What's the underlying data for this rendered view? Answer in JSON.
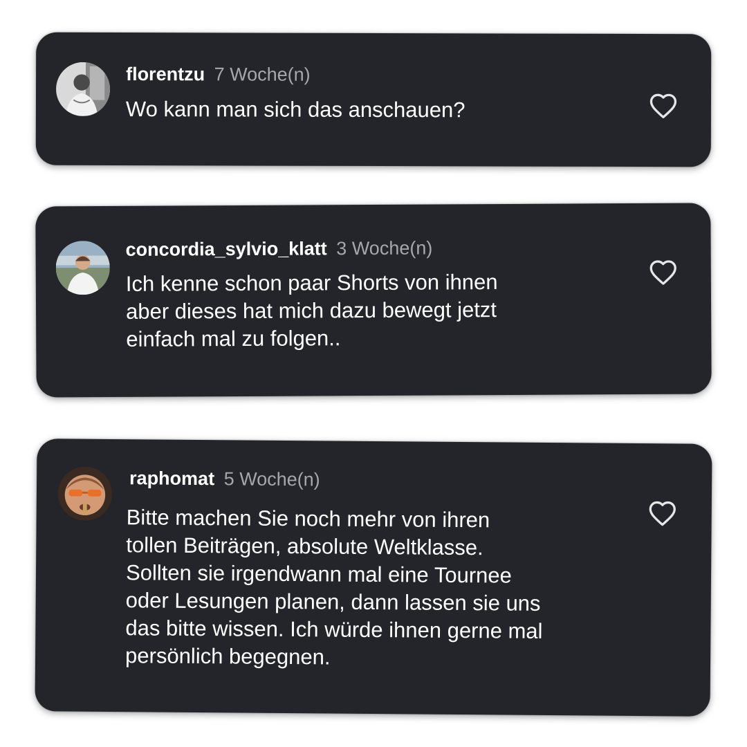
{
  "comments": [
    {
      "username": "florentzu",
      "time": "7 Woche(n)",
      "text": "Wo kann man sich das anschauen?",
      "avatar": "user-avatar-photo",
      "like_icon": "heart-outline-icon"
    },
    {
      "username": "concordia_sylvio_klatt",
      "time": "3 Woche(n)",
      "text": "Ich kenne schon paar Shorts von ihnen\naber dieses hat mich dazu bewegt jetzt\neinfach mal zu folgen..",
      "avatar": "user-avatar-photo",
      "like_icon": "heart-outline-icon"
    },
    {
      "username": "raphomat",
      "time": "5 Woche(n)",
      "text": "Bitte machen Sie noch mehr von ihren\ntollen Beiträgen, absolute Weltklasse.\nSollten sie irgendwann mal eine Tournee\noder Lesungen planen, dann lassen sie uns\ndas bitte wissen. Ich würde ihnen gerne mal\npersönlich begegnen.",
      "avatar": "user-avatar-photo",
      "like_icon": "heart-outline-icon"
    }
  ],
  "colors": {
    "page_background": "#ffffff",
    "card_background": "#24252a",
    "username": "#ffffff",
    "timestamp": "#a6a7ab",
    "comment_text": "#ffffff",
    "heart_outline": "#e6e6e8"
  }
}
